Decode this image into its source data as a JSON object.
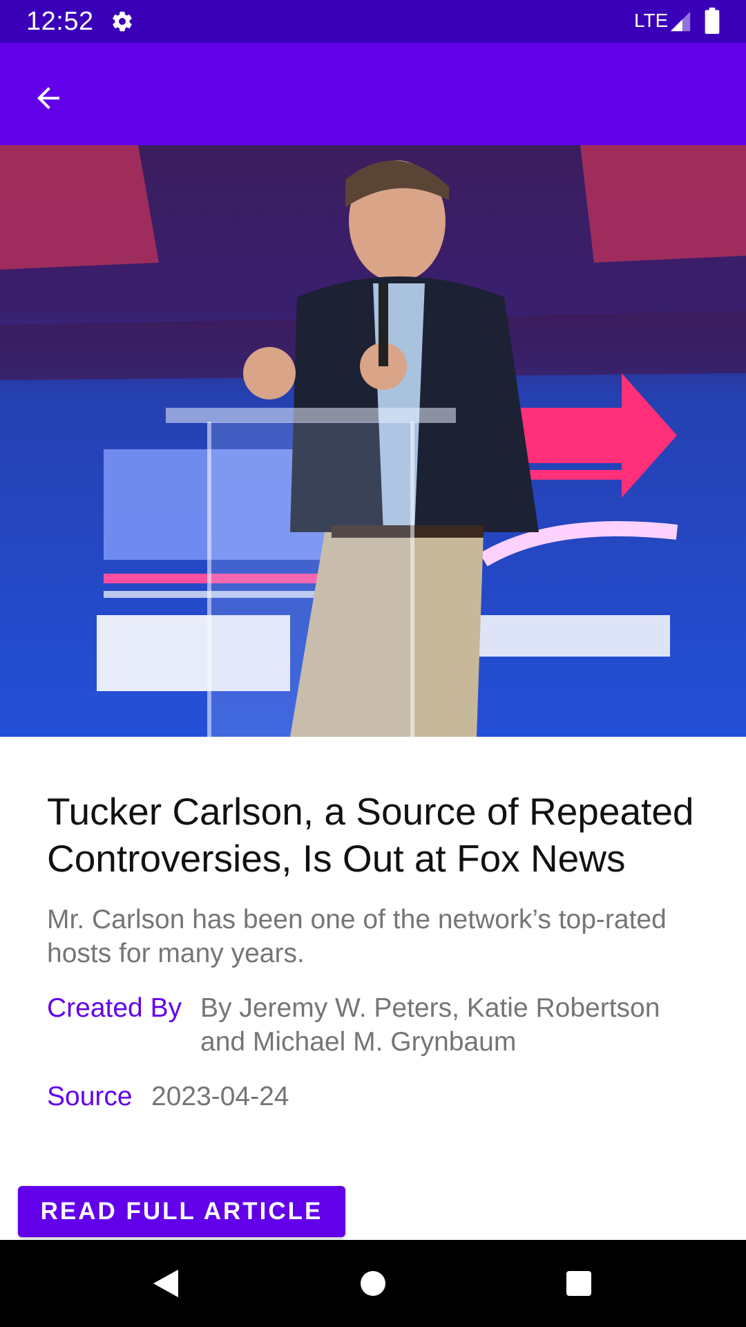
{
  "status_bar": {
    "time": "12:52",
    "network": "LTE",
    "icons": [
      "settings-gear-icon",
      "signal-icon",
      "battery-icon"
    ]
  },
  "app_bar": {
    "back_icon": "arrow-back-icon",
    "color": "#6200ea"
  },
  "hero_image": {
    "description_icon": "article-photo"
  },
  "article": {
    "title": "Tucker Carlson, a Source of Repeated Controversies, Is Out at Fox News",
    "description": "Mr. Carlson has been one of the network’s top-rated hosts for many years.",
    "created_by_label": "Created By",
    "created_by_value": "By Jeremy W. Peters, Katie Robertson and Michael M. Grynbaum",
    "source_label": "Source",
    "source_value": "2023-04-24",
    "read_button_label": "READ FULL ARTICLE"
  },
  "nav_bar": {
    "icons": [
      "back-triangle-icon",
      "home-circle-icon",
      "recents-square-icon"
    ]
  },
  "colors": {
    "status_bar": "#3a00b8",
    "accent": "#6200ea",
    "text_primary": "#111111",
    "text_secondary": "#757575"
  }
}
